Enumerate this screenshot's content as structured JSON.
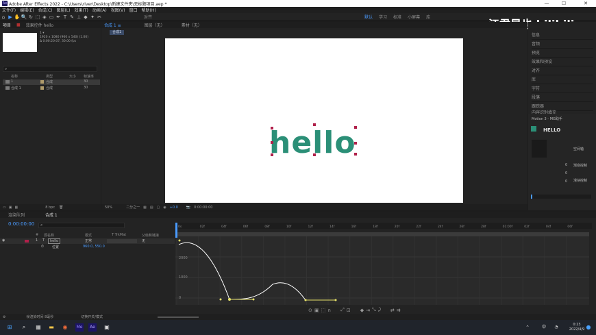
{
  "window": {
    "title": "Adobe After Effects 2022 - C:\\Users\\river\\Desktop\\新建文件夹\\无标题项目.aep *",
    "app_icon": "Ae",
    "minimize": "—",
    "maximize": "☐",
    "close": "✕"
  },
  "menu": [
    "文件(F)",
    "编辑(E)",
    "合成(C)",
    "图层(L)",
    "效果(T)",
    "动画(A)",
    "视图(V)",
    "窗口",
    "帮助(H)"
  ],
  "toolbar": {
    "tools": [
      "⌂",
      "▶",
      "✋",
      "🔍",
      "↻",
      "⬚",
      "◈",
      "▭",
      "✒",
      "T",
      "✎",
      "⊥",
      "◆",
      "✦",
      "✂"
    ],
    "align_label": "对齐",
    "workspaces": [
      "默认",
      "学习",
      "标准",
      "小屏幕",
      "库"
    ],
    "active_workspace": "默认"
  },
  "watermark": "江君是也 bilibili",
  "project": {
    "tab_project": "项目",
    "tab_effects": "效果控件 hello",
    "comp_name": "1 ▾",
    "comp_size": "1920 x 1080 (960 x 540) (1.00)",
    "comp_duration": "Δ 0:00:20:07, 30.00 fps",
    "search_placeholder": "",
    "columns": [
      "名称",
      "类型",
      "大小",
      "帧速率"
    ],
    "rows": [
      {
        "name": "1",
        "type": "合成",
        "rate": "30"
      },
      {
        "name": "合成 1",
        "type": "合成",
        "rate": "30"
      }
    ],
    "footer_bpc": "8 bpc"
  },
  "viewer": {
    "tab_comp": "合成 1 ≡",
    "tab_layer": "图层（无）",
    "tab_footage": "素材（无）",
    "comp_chip": "合成1",
    "text": "hello",
    "zoom": "50%",
    "resolution": "二分之一",
    "exposure": "+0.0",
    "timecode": "0:00:00:00"
  },
  "right_panel": {
    "items": [
      "信息",
      "音频",
      "预览",
      "效果和预设",
      "对齐",
      "库",
      "字符",
      "段落",
      "跟踪器",
      "内容识别填充"
    ],
    "motion_title": "Motion 3 - MG助手",
    "text_label": "HELLO",
    "labels": [
      "空间轴",
      "渐变控制",
      "滑块控制"
    ],
    "values": [
      "0",
      "0",
      "0"
    ]
  },
  "timeline": {
    "tab_render": "渲染队列",
    "tab_comp": "合成 1",
    "timecode": "0:00:00:00",
    "columns": [
      "#",
      "源名称",
      "模式",
      "T TrkMat",
      "父级和链接"
    ],
    "layer": {
      "index": "1",
      "type": "T",
      "name": "hello",
      "mode": "正常",
      "parent": "无"
    },
    "prop": {
      "name": "位置",
      "value": "960.0, 550.0"
    },
    "ticks": [
      "0s",
      "02f",
      "04f",
      "06f",
      "08f",
      "10f",
      "12f",
      "14f",
      "16f",
      "18f",
      "20f",
      "22f",
      "24f",
      "26f",
      "28f",
      "01:00f",
      "02f",
      "04f",
      "06f"
    ],
    "graph_labels": [
      "2000",
      "1000",
      "0"
    ],
    "footer_left": "帧渲染时间 8毫秒",
    "footer_mid": "切换开关/模式"
  },
  "taskbar": {
    "time": "0:23",
    "date": "2022/4/9",
    "lang": "中",
    "apps": [
      "⊞",
      "⌕",
      "▦",
      "▬",
      "◉",
      "Me",
      "Ae",
      "▣",
      "✦"
    ]
  },
  "colors": {
    "accent_blue": "#4a9bff",
    "text_green": "#2b8f77",
    "handle_red": "#b0204a",
    "curve_yellow": "#e8e36a"
  }
}
